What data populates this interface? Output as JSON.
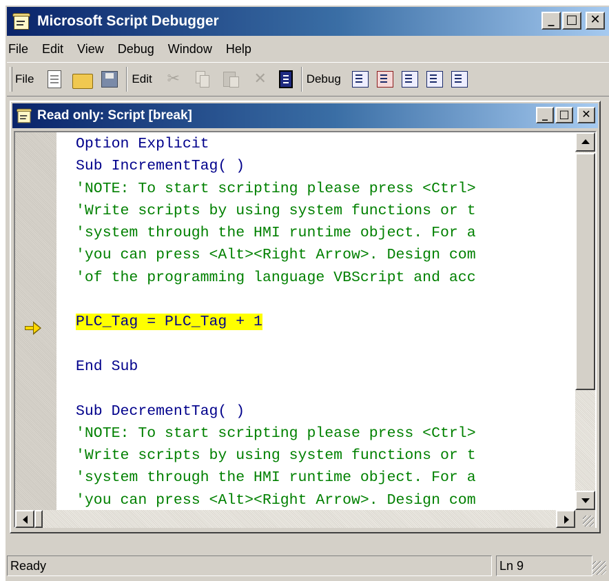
{
  "window": {
    "title": "Microsoft Script Debugger",
    "minimize_glyph": "_",
    "maximize_glyph": "□",
    "close_glyph": "✕"
  },
  "menu": [
    {
      "label": "File"
    },
    {
      "label": "Edit"
    },
    {
      "label": "View"
    },
    {
      "label": "Debug"
    },
    {
      "label": "Window"
    },
    {
      "label": "Help"
    }
  ],
  "toolbar": {
    "file_label": "File",
    "edit_label": "Edit",
    "debug_label": "Debug",
    "cut_glyph": "✂",
    "delete_glyph": "✕"
  },
  "child_window": {
    "title": "Read only: Script [break]"
  },
  "code": {
    "current_line": "PLC_Tag = PLC_Tag + 1",
    "lines": [
      "Option Explicit",
      "Sub IncrementTag( )",
      "'NOTE: To start scripting please press <Ctrl>",
      "'Write scripts by using system functions or t",
      "'system through the HMI runtime object. For a",
      "'you can press <Alt><Right Arrow>. Design com",
      "'of the programming language VBScript and acc",
      "",
      "PLC_Tag = PLC_Tag + 1",
      "",
      "End Sub",
      "",
      "Sub DecrementTag( )",
      "'NOTE: To start scripting please press <Ctrl>",
      "'Write scripts by using system functions or t",
      "'system through the HMI runtime object. For a",
      "'you can press <Alt><Right Arrow>. Design com"
    ]
  },
  "colors": {
    "keyword": "#00008b",
    "comment": "#008000",
    "highlight": "#ffff00",
    "titlebar_start": "#0a246a",
    "titlebar_end": "#a6caf0",
    "chrome": "#d4d0c8"
  },
  "status": {
    "message": "Ready",
    "line": "Ln 9"
  }
}
